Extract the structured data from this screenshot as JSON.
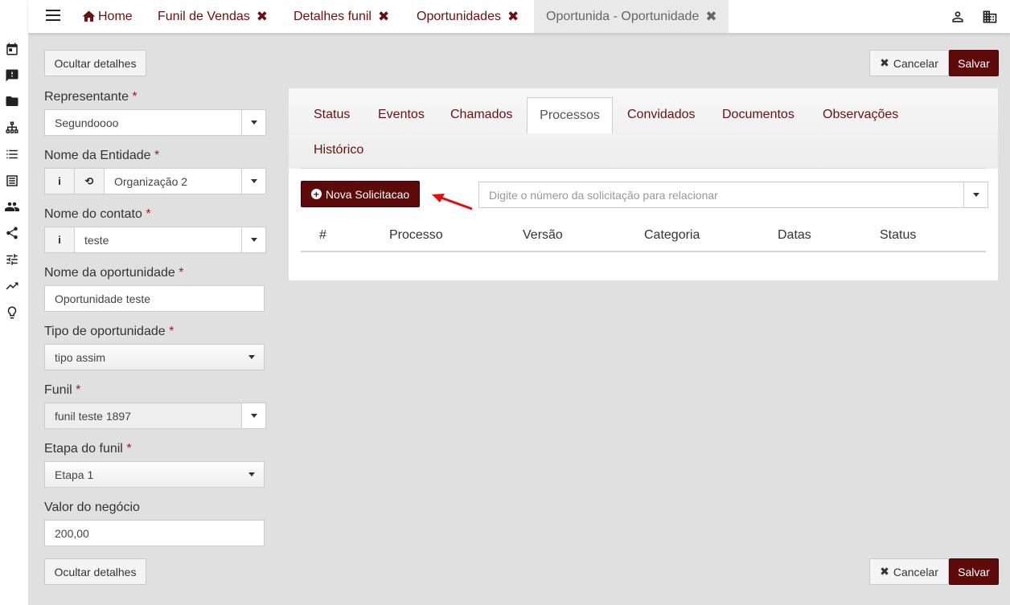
{
  "rail": {
    "icons": [
      "calendar-icon",
      "feedback-icon",
      "folder-icon",
      "sitemap-icon",
      "list-icon",
      "document-list-icon",
      "people-icon",
      "share-icon",
      "sliders-icon",
      "trending-icon",
      "lightbulb-icon"
    ]
  },
  "topbar": {
    "tabs": [
      {
        "label": "Home",
        "icon": "home-icon"
      },
      {
        "label": "Funil de Vendas",
        "close": "✖"
      },
      {
        "label": "Detalhes funil",
        "close": "✖"
      },
      {
        "label": "Oportunidades",
        "close": "✖"
      },
      {
        "label": "Oportunida - Oportunidade",
        "close": "✖"
      }
    ],
    "right_icons": [
      "user-icon",
      "building-icon"
    ]
  },
  "actions": {
    "hide_details": "Ocultar detalhes",
    "cancel": "Cancelar",
    "cancel_icon": "✖",
    "save": "Salvar"
  },
  "form": {
    "required_mark": "*",
    "representante": {
      "label": "Representante",
      "value": "Segundoooo"
    },
    "entidade": {
      "label": "Nome da Entidade",
      "value": "Organização 2"
    },
    "contato": {
      "label": "Nome do contato",
      "value": "teste"
    },
    "oportunidade": {
      "label": "Nome da oportunidade",
      "value": "Oportunidade teste"
    },
    "tipo": {
      "label": "Tipo de oportunidade",
      "value": "tipo assim"
    },
    "funil": {
      "label": "Funil",
      "value": "funil teste 1897"
    },
    "etapa": {
      "label": "Etapa do funil",
      "value": "Etapa 1"
    },
    "valor": {
      "label": "Valor do negócio",
      "value": "200,00"
    }
  },
  "panel": {
    "tabs": [
      "Status",
      "Eventos",
      "Chamados",
      "Processos",
      "Convidados",
      "Documentos",
      "Observações",
      "Histórico"
    ],
    "active_tab": "Processos",
    "new_button": "Nova Solicitacao",
    "search_placeholder": "Digite o número da solicitação para relacionar",
    "columns": [
      "#",
      "Processo",
      "Versão",
      "Categoria",
      "Datas",
      "Status"
    ]
  },
  "colors": {
    "accent": "#5c0a0a",
    "link": "#6b0f0f",
    "annotation_arrow": "#e01010"
  }
}
